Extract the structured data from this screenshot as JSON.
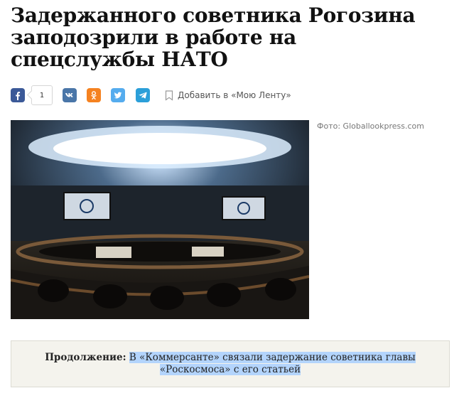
{
  "article": {
    "title": "Задержанного советника Рогозина заподозрили в работе на спецслужбы НАТО"
  },
  "share": {
    "facebook_icon": "facebook-icon",
    "facebook_count": "1",
    "vk_icon": "vk-icon",
    "ok_icon": "odnoklassniki-icon",
    "twitter_icon": "twitter-icon",
    "telegram_icon": "telegram-icon",
    "bookmark_label": "Добавить в «Мою Ленту»",
    "colors": {
      "facebook": "#3b5998",
      "vk": "#4a76a8",
      "ok": "#f58220",
      "twitter": "#55acee",
      "telegram": "#2b9fd9"
    }
  },
  "photo": {
    "credit": "Фото: Globallookpress.com"
  },
  "continuation": {
    "label": "Продолжение:",
    "link_text": "В «Коммерсанте» связали задержание советника главы «Роскосмоса» с его статьей"
  }
}
